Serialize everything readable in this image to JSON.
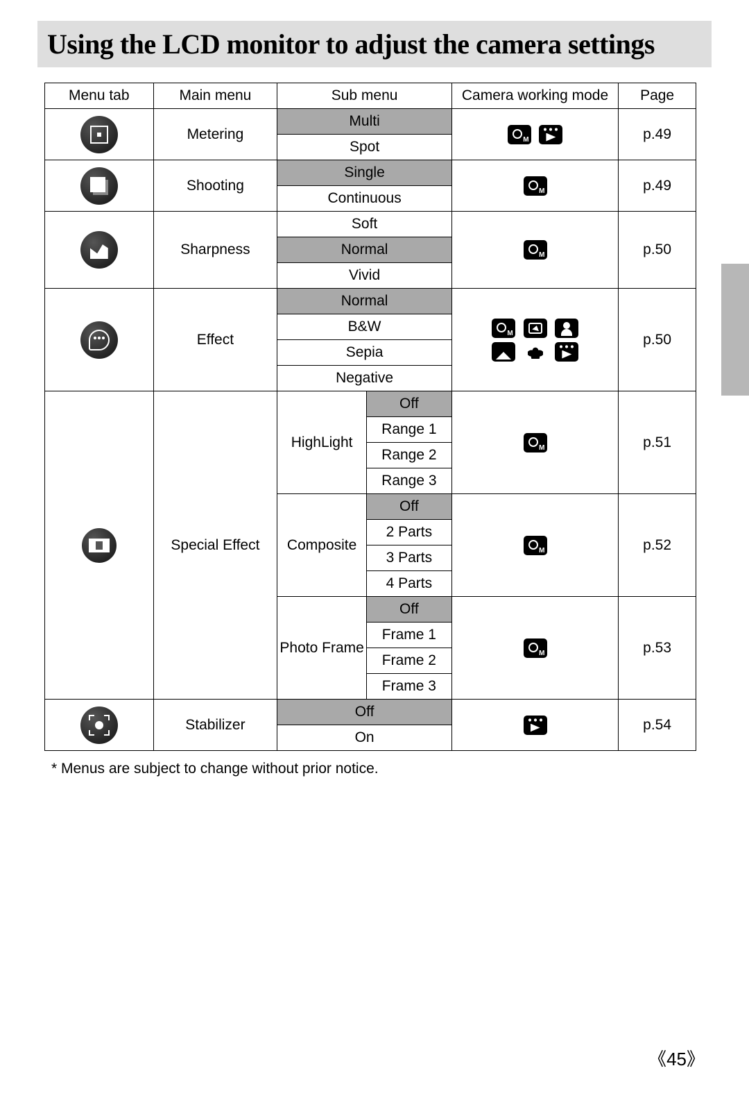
{
  "title": "Using the LCD monitor to adjust the camera settings",
  "headers": {
    "menu_tab": "Menu tab",
    "main_menu": "Main menu",
    "sub_menu": "Sub menu",
    "mode": "Camera working mode",
    "page": "Page"
  },
  "rows": {
    "metering": {
      "main": "Metering",
      "subs": [
        "Multi",
        "Spot"
      ],
      "defaults": [
        "Multi"
      ],
      "modes": [
        "camera-m",
        "movie"
      ],
      "page": "p.49"
    },
    "shooting": {
      "main": "Shooting",
      "subs": [
        "Single",
        "Continuous"
      ],
      "defaults": [
        "Single"
      ],
      "modes": [
        "camera-m"
      ],
      "page": "p.49"
    },
    "sharpness": {
      "main": "Sharpness",
      "subs": [
        "Soft",
        "Normal",
        "Vivid"
      ],
      "defaults": [
        "Normal"
      ],
      "modes": [
        "camera-m"
      ],
      "page": "p.50"
    },
    "effect": {
      "main": "Effect",
      "subs": [
        "Normal",
        "B&W",
        "Sepia",
        "Negative"
      ],
      "defaults": [
        "Normal"
      ],
      "modes": [
        "camera-m",
        "scene",
        "portrait",
        "landscape",
        "closeup",
        "movie"
      ],
      "page": "p.50"
    },
    "special": {
      "main": "Special Effect",
      "groups": {
        "highlight": {
          "label": "HighLight",
          "subs": [
            "Off",
            "Range 1",
            "Range 2",
            "Range 3"
          ],
          "defaults": [
            "Off"
          ],
          "modes": [
            "camera-m"
          ],
          "page": "p.51"
        },
        "composite": {
          "label": "Composite",
          "subs": [
            "Off",
            "2 Parts",
            "3 Parts",
            "4 Parts"
          ],
          "defaults": [
            "Off"
          ],
          "modes": [
            "camera-m"
          ],
          "page": "p.52"
        },
        "photoframe": {
          "label": "Photo Frame",
          "subs": [
            "Off",
            "Frame 1",
            "Frame 2",
            "Frame 3"
          ],
          "defaults": [
            "Off"
          ],
          "modes": [
            "camera-m"
          ],
          "page": "p.53"
        }
      }
    },
    "stabilizer": {
      "main": "Stabilizer",
      "subs": [
        "Off",
        "On"
      ],
      "defaults": [
        "Off"
      ],
      "modes": [
        "movie"
      ],
      "page": "p.54"
    }
  },
  "footnote": "* Menus are subject to change without prior notice.",
  "page_number": "45",
  "page_number_decor": {
    "left": "《",
    "right": "》"
  }
}
